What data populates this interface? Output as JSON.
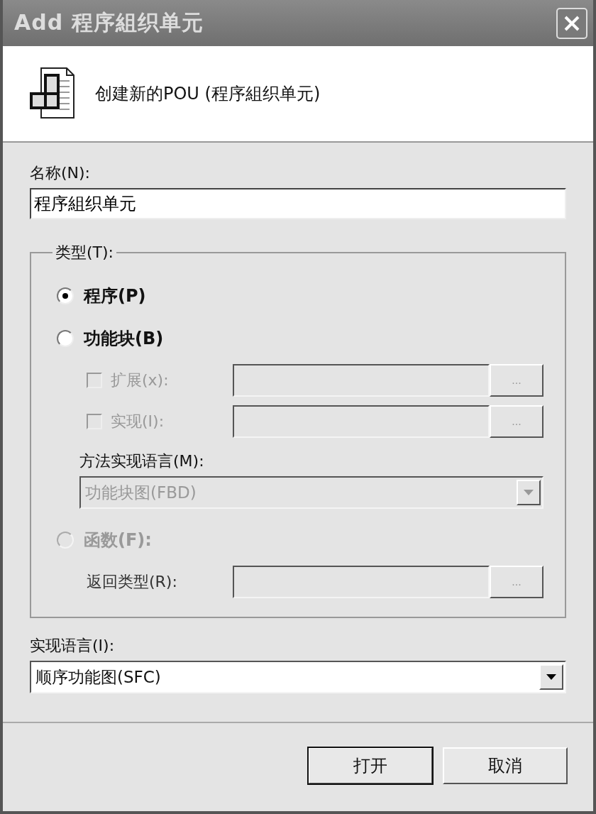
{
  "window": {
    "title": "Add 程序組织单元"
  },
  "header": {
    "text": "创建新的POU (程序組织单元)"
  },
  "name_field": {
    "label": "名称(N):",
    "value": "程序組织单元"
  },
  "type_group": {
    "label": "类型(T):",
    "items": [
      {
        "kind": "radio",
        "label": "程序(P)",
        "selected": true,
        "disabled": false
      },
      {
        "kind": "radio",
        "label": "功能块(B)",
        "selected": false,
        "disabled": false
      },
      {
        "kind": "checkbox_field",
        "label": "扩展(x):",
        "checked": false,
        "disabled": true,
        "button": "..."
      },
      {
        "kind": "checkbox_field",
        "label": "实现(I):",
        "checked": false,
        "disabled": true,
        "button": "..."
      },
      {
        "kind": "dropdown",
        "label": "方法实现语言(M):",
        "value": "功能块图(FBD)",
        "disabled": true
      },
      {
        "kind": "radio",
        "label": "函数(F):",
        "selected": false,
        "disabled": true
      },
      {
        "kind": "label_field",
        "label": "返回类型(R):",
        "disabled": true,
        "button": "..."
      }
    ]
  },
  "implementation_language": {
    "label": "实现语言(I):",
    "value": "顺序功能图(SFC)"
  },
  "buttons": [
    {
      "label": "打开",
      "default": true
    },
    {
      "label": "取消",
      "default": false
    }
  ]
}
